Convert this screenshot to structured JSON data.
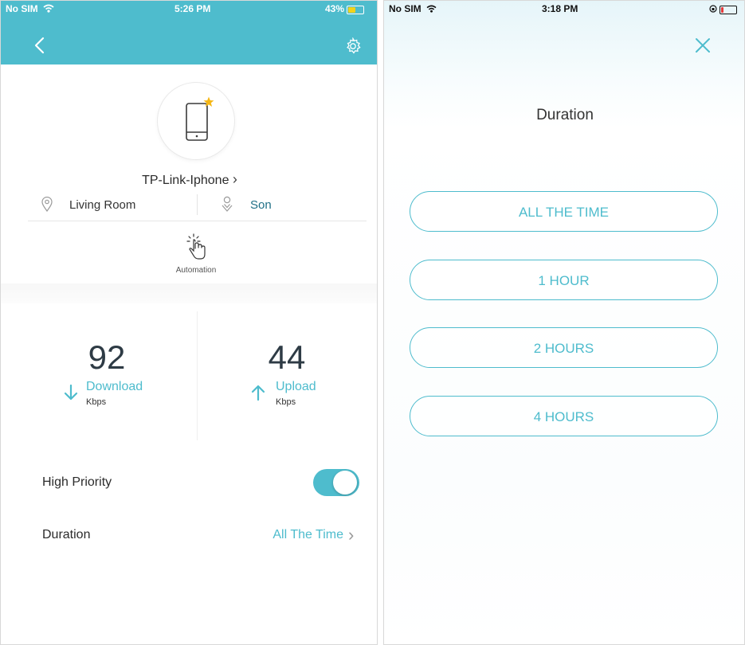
{
  "left_screen": {
    "status_bar": {
      "carrier": "No SIM",
      "time": "5:26 PM",
      "battery": "43%"
    },
    "nav": {
      "back_icon": "chevron-left-icon",
      "settings_icon": "gear-icon"
    },
    "device": {
      "icon": "phone-icon",
      "name": "TP-Link-Iphone",
      "name_chevron": "›"
    },
    "location": {
      "icon": "location-pin-icon",
      "label": "Living Room"
    },
    "owner": {
      "icon": "person-icon",
      "label": "Son"
    },
    "automation": {
      "icon": "tap-hand-icon",
      "label": "Automation"
    },
    "download": {
      "value": "92",
      "label": "Download",
      "unit": "Kbps"
    },
    "upload": {
      "value": "44",
      "label": "Upload",
      "unit": "Kbps"
    },
    "high_priority": {
      "label": "High Priority",
      "enabled": true
    },
    "duration": {
      "label": "Duration",
      "value": "All The Time",
      "chevron": "›"
    },
    "accent_color": "#4ebccd"
  },
  "right_screen": {
    "status_bar": {
      "carrier": "No SIM",
      "time": "3:18 PM"
    },
    "close_icon": "close-icon",
    "title": "Duration",
    "options": [
      "ALL THE TIME",
      "1 HOUR",
      "2 HOURS",
      "4 HOURS"
    ]
  }
}
